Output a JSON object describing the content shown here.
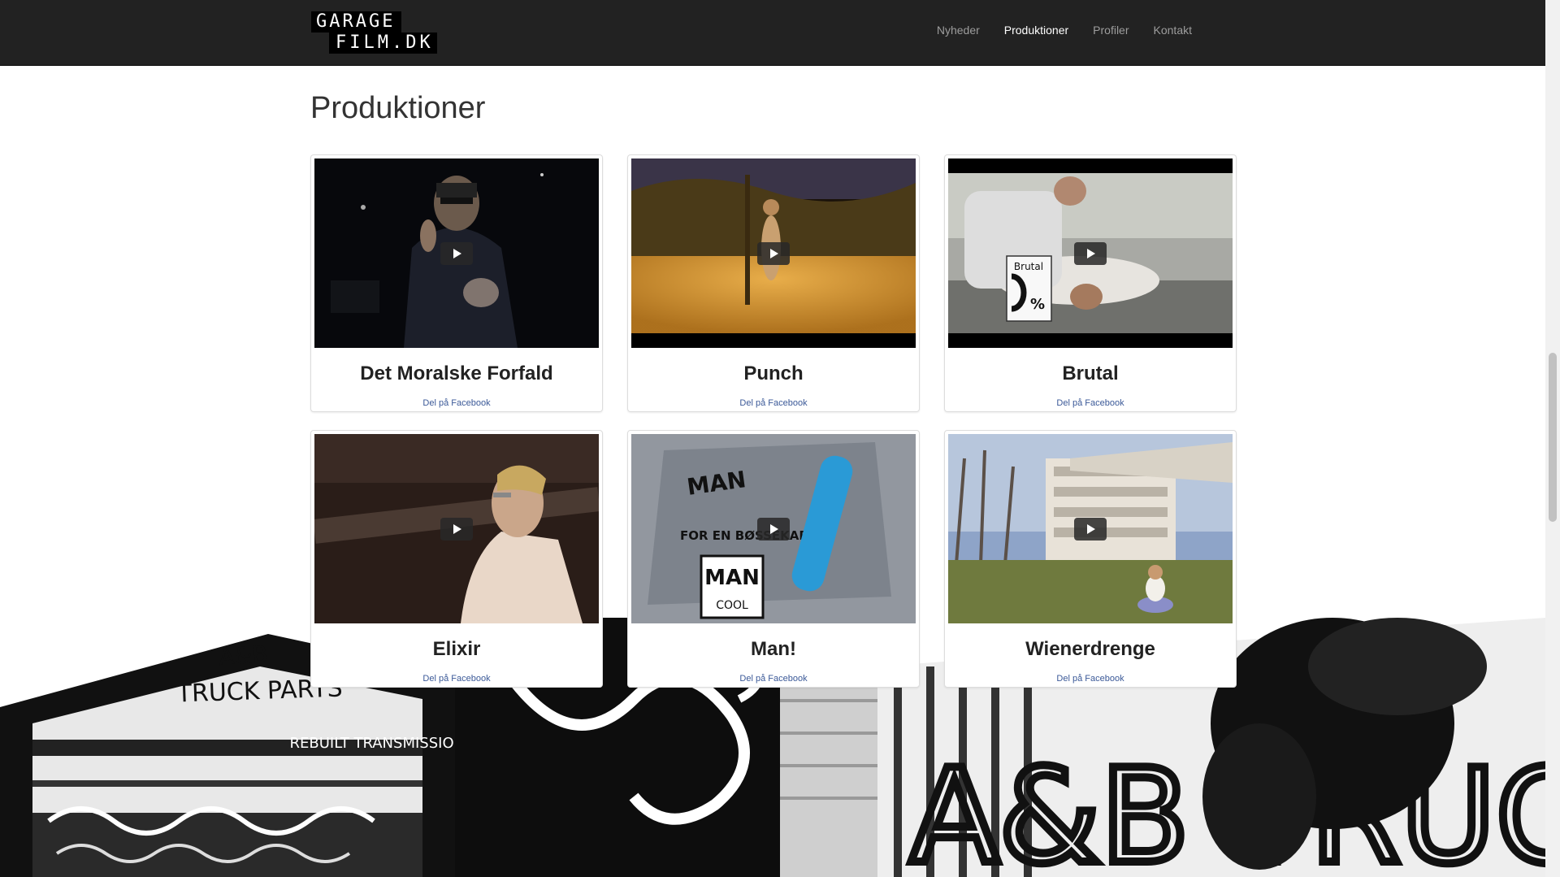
{
  "brand": {
    "line1": "GARAGE",
    "line2": "FILM.DK"
  },
  "nav": {
    "items": [
      {
        "label": "Nyheder",
        "active": false
      },
      {
        "label": "Produktioner",
        "active": true
      },
      {
        "label": "Profiler",
        "active": false
      },
      {
        "label": "Kontakt",
        "active": false
      }
    ]
  },
  "page": {
    "title": "Produktioner"
  },
  "productions": [
    {
      "title": "Det Moralske Forfald",
      "share_label": "Del på Facebook"
    },
    {
      "title": "Punch",
      "share_label": "Del på Facebook"
    },
    {
      "title": "Brutal",
      "share_label": "Del på Facebook",
      "thumb_text": "Brutal",
      "thumb_percent": "%"
    },
    {
      "title": "Elixir",
      "share_label": "Del på Facebook"
    },
    {
      "title": "Man!",
      "share_label": "Del på Facebook",
      "thumb_text": "MAN",
      "thumb_sub": "COOL",
      "thumb_tag": "FOR EN BØSSEKARL!"
    },
    {
      "title": "Wienerdrenge",
      "share_label": "Del på Facebook"
    }
  ],
  "background": {
    "sign_top": "A&B",
    "sign_mid": "TRUCK PARTS",
    "sign_sub": "REBUILT TRANSMISSIONS",
    "sign_big": "A&B TRUC  AR"
  }
}
